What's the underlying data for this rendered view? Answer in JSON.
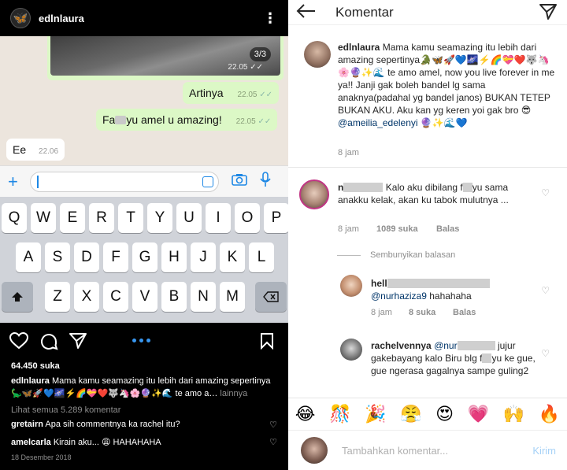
{
  "whatsapp": {
    "image_counter": "3/3",
    "image_time": "22.05",
    "messages": [
      {
        "text": "Artinya",
        "time": "22.05",
        "dir": "out"
      },
      {
        "text_pre": "Fa",
        "text_post": "yu amel u amazing!",
        "time": "22.05",
        "dir": "out"
      },
      {
        "text": "Ee",
        "time": "22.06",
        "dir": "in"
      }
    ],
    "keyboard": {
      "row1": [
        "Q",
        "W",
        "E",
        "R",
        "T",
        "Y",
        "U",
        "I",
        "O",
        "P"
      ],
      "row2": [
        "A",
        "S",
        "D",
        "F",
        "G",
        "H",
        "J",
        "K",
        "L"
      ],
      "row3": [
        "Z",
        "X",
        "C",
        "V",
        "B",
        "N",
        "M"
      ]
    }
  },
  "instagram": {
    "username": "edlnlaura",
    "likes": "64.450 suka",
    "caption_user": "edlnlaura",
    "caption_text": "Mama kamu seamazing itu lebih dari amazing sepertinya",
    "caption_emojis": "🦕🦋🚀💙🌌⚡️🌈💝❤️🐺🦄🌸🔮✨🌊",
    "caption_more_text": "te amo a…",
    "caption_more_link": "lainnya",
    "view_all": "Lihat semua 5.289 komentar",
    "comments": [
      {
        "user": "gretairn",
        "text": "Apa sih commentnya ka rachel itu?"
      },
      {
        "user": "amelcarla",
        "text": "Kirain aku... 😩 HAHAHAHA"
      }
    ],
    "date": "18 Desember 2018"
  },
  "comments_screen": {
    "title": "Komentar",
    "post": {
      "user": "edlnlaura",
      "text": "Mama kamu seamazing itu lebih dari amazing sepertinya🐊🦋🚀💙🌌⚡️🌈💝❤️🐺🦄🌸🔮✨🌊 te amo amel, now you live forever in me ya!! Janji gak boleh bandel lg sama anaknya(padahal yg bandel janos) BUKAN TETEP BUKAN AKU. Aku kan yg keren yoi gak bro 😎",
      "mention": "@ameilia_edelenyi",
      "tail_emojis": "🔮✨🌊💙",
      "time": "8 jam"
    },
    "c1": {
      "user_pre": "n",
      "text_a": "Kalo aku dibilang f",
      "text_b": "yu",
      "text_c": "sama anakku kelak, akan ku tabok mulutnya ...",
      "time": "8 jam",
      "likes": "1089 suka",
      "reply": "Balas"
    },
    "hide_replies": "Sembunyikan balasan",
    "c2": {
      "user_pre": "hell",
      "mention": "@nurhaziza9",
      "text": "hahahaha",
      "time": "8 jam",
      "likes": "8 suka",
      "reply": "Balas"
    },
    "c3": {
      "user": "rachelvennya",
      "mention_pre": "@nur",
      "text_a": "jujur gakebayang kalo Biru blg f",
      "text_b": "yu ke gue, gue ngerasa gagalnya sampe guling2"
    },
    "emojis": [
      "😂",
      "🎊",
      "🎉",
      "😤",
      "😍",
      "💗",
      "🙌",
      "🔥"
    ],
    "add_placeholder": "Tambahkan komentar...",
    "send_label": "Kirim"
  }
}
